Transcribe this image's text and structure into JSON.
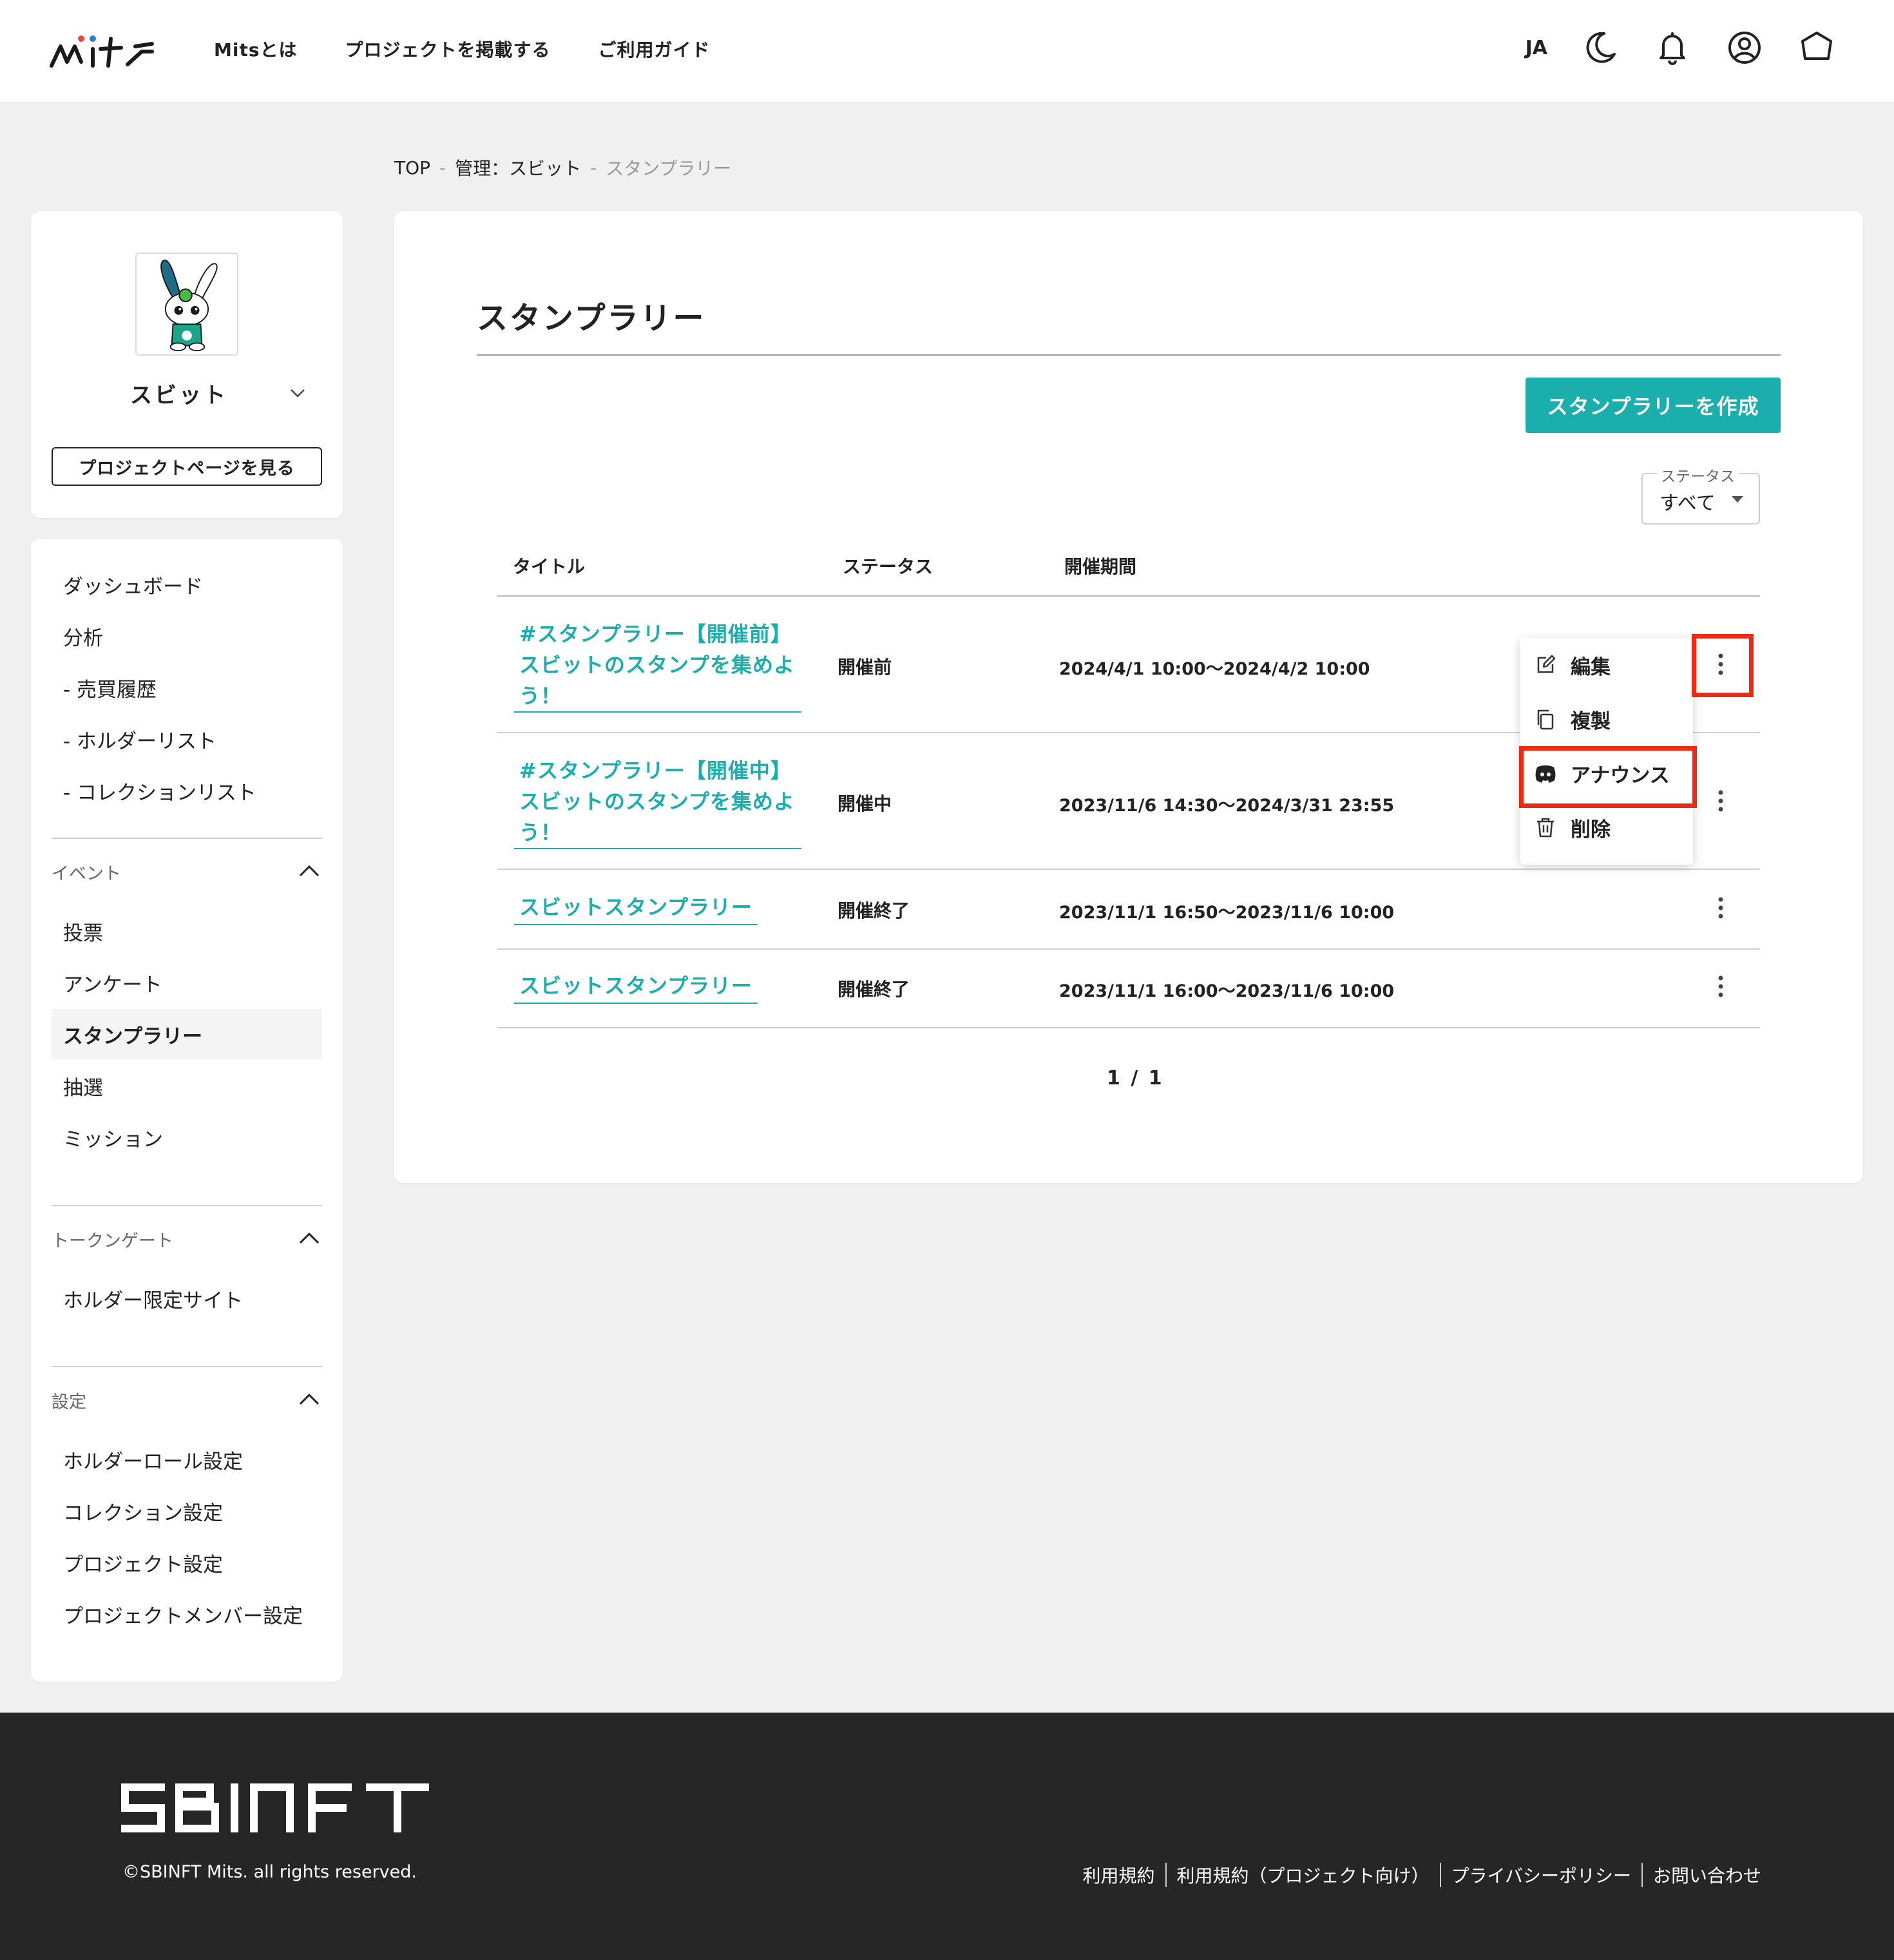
{
  "header": {
    "nav": [
      "Mitsとは",
      "プロジェクトを掲載する",
      "ご利用ガイド"
    ],
    "lang": "JA"
  },
  "breadcrumb": {
    "top": "TOP",
    "sep": "-",
    "manage": "管理：スビット",
    "current": "スタンプラリー"
  },
  "profile": {
    "name": "スビット",
    "project_button": "プロジェクトページを見る"
  },
  "menu": {
    "top_items": [
      "ダッシュボード",
      "分析",
      "- 売買履歴",
      "- ホルダーリスト",
      "- コレクションリスト"
    ],
    "sections": [
      {
        "label": "イベント",
        "items": [
          "投票",
          "アンケート",
          "スタンプラリー",
          "抽選",
          "ミッション"
        ]
      },
      {
        "label": "トークンゲート",
        "items": [
          "ホルダー限定サイト"
        ]
      },
      {
        "label": "設定",
        "items": [
          "ホルダーロール設定",
          "コレクション設定",
          "プロジェクト設定",
          "プロジェクトメンバー設定"
        ]
      }
    ],
    "active_item": "スタンプラリー"
  },
  "main": {
    "title": "スタンプラリー",
    "create_button": "スタンプラリーを作成",
    "status_filter": {
      "label": "ステータス",
      "value": "すべて"
    },
    "columns": [
      "タイトル",
      "ステータス",
      "開催期間"
    ],
    "rows": [
      {
        "title_lines": [
          "#スタンプラリー【開催前】",
          "スビットのスタンプを集めよ",
          "う！"
        ],
        "status": "開催前",
        "period": "2024/4/1 10:00〜2024/4/2 10:00"
      },
      {
        "title_lines": [
          "#スタンプラリー【開催中】",
          "スビットのスタンプを集めよ",
          "う！"
        ],
        "status": "開催中",
        "period": "2023/11/6 14:30〜2024/3/31 23:55"
      },
      {
        "title_lines": [
          "スビットスタンプラリー"
        ],
        "status": "開催終了",
        "period": "2023/11/1 16:50〜2023/11/6 10:00"
      },
      {
        "title_lines": [
          "スビットスタンプラリー"
        ],
        "status": "開催終了",
        "period": "2023/11/1 16:00〜2023/11/6 10:00"
      }
    ],
    "dropdown": [
      "編集",
      "複製",
      "アナウンス",
      "削除"
    ],
    "pagination": "1 / 1"
  },
  "footer": {
    "copyright": "©SBINFT Mits. all rights reserved.",
    "links": [
      "利用規約",
      "利用規約（プロジェクト向け）",
      "プライバシーポリシー",
      "お問い合わせ"
    ]
  },
  "colors": {
    "accent": "#1aaead",
    "highlight": "#ee2a12",
    "footer_bg": "#262626",
    "page_bg": "#f0f0f0"
  },
  "icons": [
    "mits-logo",
    "moon-icon",
    "bell-icon",
    "user-circle-icon",
    "hexagon-icon",
    "chevron-down-icon",
    "chevron-up-icon",
    "kebab-icon",
    "edit-icon",
    "copy-icon",
    "discord-icon",
    "trash-icon",
    "sbinft-logo"
  ]
}
